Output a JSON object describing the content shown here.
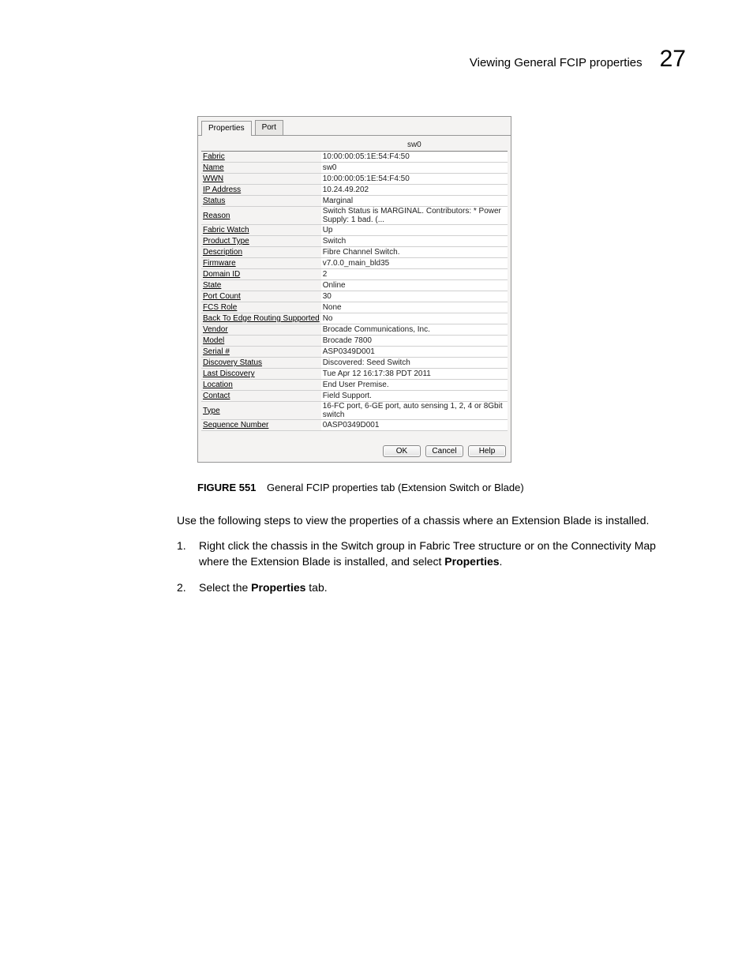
{
  "header": {
    "title": "Viewing General FCIP properties",
    "page_num": "27"
  },
  "dialog": {
    "tabs": [
      {
        "label": "Properties"
      },
      {
        "label": "Port"
      }
    ],
    "column_header": "sw0",
    "rows": [
      {
        "label": "Fabric",
        "value": "10:00:00:05:1E:54:F4:50"
      },
      {
        "label": "Name",
        "value": "sw0"
      },
      {
        "label": "WWN",
        "value": "10:00:00:05:1E:54:F4:50"
      },
      {
        "label": "IP Address",
        "value": "10.24.49.202"
      },
      {
        "label": "Status",
        "value": "Marginal"
      },
      {
        "label": "Reason",
        "value": "Switch Status is MARGINAL. Contributors: * Power Supply: 1 bad. (..."
      },
      {
        "label": "Fabric Watch",
        "value": "Up"
      },
      {
        "label": "Product Type",
        "value": "Switch"
      },
      {
        "label": "Description",
        "value": "Fibre Channel Switch."
      },
      {
        "label": "Firmware",
        "value": "v7.0.0_main_bld35"
      },
      {
        "label": "Domain ID",
        "value": "2"
      },
      {
        "label": "State",
        "value": "Online"
      },
      {
        "label": "Port Count",
        "value": "30"
      },
      {
        "label": "FCS Role",
        "value": "None"
      },
      {
        "label": "Back To Edge Routing Supported",
        "value": "No"
      },
      {
        "label": "Vendor",
        "value": "Brocade Communications, Inc."
      },
      {
        "label": "Model",
        "value": "Brocade 7800"
      },
      {
        "label": "Serial #",
        "value": "ASP0349D001"
      },
      {
        "label": "Discovery Status",
        "value": "Discovered: Seed Switch"
      },
      {
        "label": "Last Discovery",
        "value": "Tue Apr 12 16:17:38 PDT 2011"
      },
      {
        "label": "Location",
        "value": "End User Premise."
      },
      {
        "label": "Contact",
        "value": "Field Support."
      },
      {
        "label": "Type",
        "value": "16-FC port, 6-GE port, auto sensing 1, 2, 4 or 8Gbit switch"
      },
      {
        "label": "Sequence Number",
        "value": "0ASP0349D001"
      }
    ],
    "buttons": {
      "ok": "OK",
      "cancel": "Cancel",
      "help": "Help"
    }
  },
  "caption": {
    "figure": "FIGURE 551",
    "text": "General FCIP properties tab (Extension Switch or Blade)"
  },
  "body": {
    "para1": "Use the following steps to view the properties of a chassis where an Extension Blade is installed.",
    "li1_pre": "Right click the chassis in the Switch group in Fabric Tree structure or on the Connectivity Map where the Extension Blade is installed, and select ",
    "li1_bold": "Properties",
    "li1_post": ".",
    "li2_pre": "Select the ",
    "li2_bold": "Properties",
    "li2_post": " tab."
  }
}
